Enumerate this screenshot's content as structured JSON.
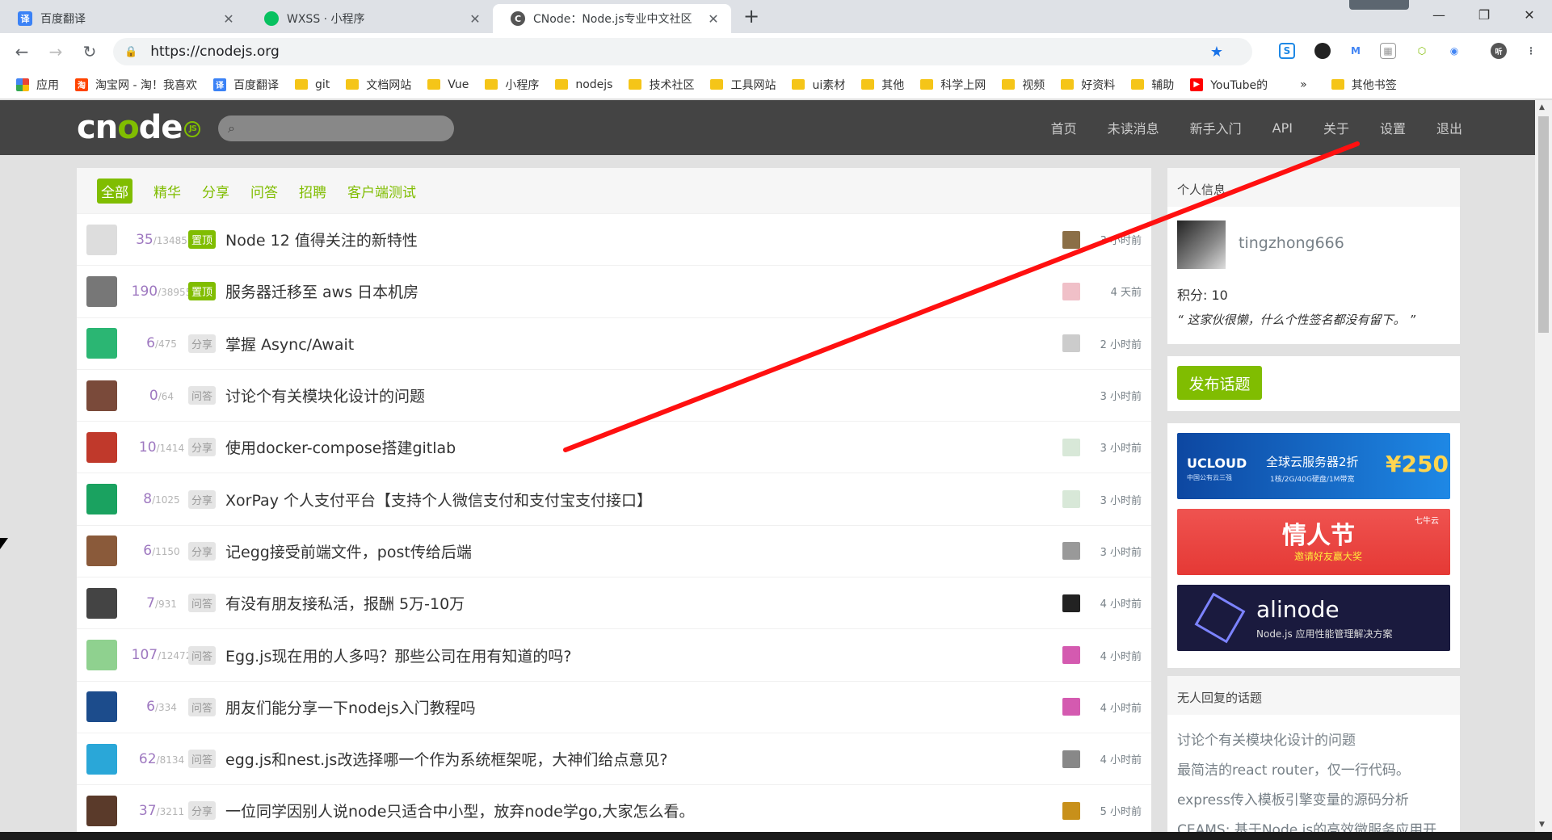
{
  "browser": {
    "tabs": [
      {
        "title": "百度翻译",
        "icon": "译",
        "color": "#3b82f6"
      },
      {
        "title": "WXSS · 小程序",
        "icon": "",
        "color": "#07c160"
      },
      {
        "title": "CNode：Node.js专业中文社区",
        "icon": "C",
        "color": "#555555"
      }
    ],
    "url": "https://cnodejs.org",
    "bookmarks": [
      {
        "label": "应用",
        "type": "apps"
      },
      {
        "label": "淘宝网 - 淘！我喜欢",
        "type": "taobao"
      },
      {
        "label": "百度翻译",
        "type": "translate"
      },
      {
        "label": "git",
        "type": "folder"
      },
      {
        "label": "文档网站",
        "type": "folder"
      },
      {
        "label": "Vue",
        "type": "folder"
      },
      {
        "label": "小程序",
        "type": "folder"
      },
      {
        "label": "nodejs",
        "type": "folder"
      },
      {
        "label": "技术社区",
        "type": "folder"
      },
      {
        "label": "工具网站",
        "type": "folder"
      },
      {
        "label": "ui素材",
        "type": "folder"
      },
      {
        "label": "其他",
        "type": "folder"
      },
      {
        "label": "科学上网",
        "type": "folder"
      },
      {
        "label": "视频",
        "type": "folder"
      },
      {
        "label": "好资料",
        "type": "folder"
      },
      {
        "label": "辅助",
        "type": "folder"
      },
      {
        "label": "YouTube的",
        "type": "youtube"
      }
    ],
    "more_bookmarks_label": "»",
    "other_bookmarks": "其他书签"
  },
  "site": {
    "menu": [
      "首页",
      "未读消息",
      "新手入门",
      "API",
      "关于",
      "设置",
      "退出"
    ],
    "tabs": [
      "全部",
      "精华",
      "分享",
      "问答",
      "招聘",
      "客户端测试"
    ],
    "topics": [
      {
        "replies": "35",
        "visits": "13485",
        "tag": "置顶",
        "tagType": "top",
        "title": "Node 12 值得关注的新特性",
        "time": "3 小时前",
        "avatar": "#ddd",
        "ravatar": "#8b6f47"
      },
      {
        "replies": "190",
        "visits": "38955",
        "tag": "置顶",
        "tagType": "top",
        "title": "服务器迁移至 aws 日本机房",
        "time": "4 天前",
        "avatar": "#777",
        "ravatar": "#f0c0c8"
      },
      {
        "replies": "6",
        "visits": "475",
        "tag": "分享",
        "tagType": "share",
        "title": "掌握 Async/Await",
        "time": "2 小时前",
        "avatar": "#2bb673",
        "ravatar": "#ccc"
      },
      {
        "replies": "0",
        "visits": "64",
        "tag": "问答",
        "tagType": "ask",
        "title": "讨论个有关模块化设计的问题",
        "time": "3 小时前",
        "avatar": "#7a4a3a",
        "ravatar": ""
      },
      {
        "replies": "10",
        "visits": "1414",
        "tag": "分享",
        "tagType": "share",
        "title": "使用docker-compose搭建gitlab",
        "time": "3 小时前",
        "avatar": "#c0392b",
        "ravatar": "#d8e8d8"
      },
      {
        "replies": "8",
        "visits": "1025",
        "tag": "分享",
        "tagType": "share",
        "title": "XorPay 个人支付平台【支持个人微信支付和支付宝支付接口】",
        "time": "3 小时前",
        "avatar": "#1aa260",
        "ravatar": "#d8e8d8"
      },
      {
        "replies": "6",
        "visits": "1150",
        "tag": "分享",
        "tagType": "share",
        "title": "记egg接受前端文件，post传给后端",
        "time": "3 小时前",
        "avatar": "#8a5a3a",
        "ravatar": "#999"
      },
      {
        "replies": "7",
        "visits": "931",
        "tag": "问答",
        "tagType": "ask",
        "title": "有没有朋友接私活，报酬 5万-10万",
        "time": "4 小时前",
        "avatar": "#444",
        "ravatar": "#222"
      },
      {
        "replies": "107",
        "visits": "12472",
        "tag": "问答",
        "tagType": "ask",
        "title": "Egg.js现在用的人多吗？那些公司在用有知道的吗?",
        "time": "4 小时前",
        "avatar": "#8fd18f",
        "ravatar": "#d45ab0"
      },
      {
        "replies": "6",
        "visits": "334",
        "tag": "问答",
        "tagType": "ask",
        "title": "朋友们能分享一下nodejs入门教程吗",
        "time": "4 小时前",
        "avatar": "#1c4c8c",
        "ravatar": "#d45ab0"
      },
      {
        "replies": "62",
        "visits": "8134",
        "tag": "问答",
        "tagType": "ask",
        "title": "egg.js和nest.js改选择哪一个作为系统框架呢，大神们给点意见?",
        "time": "4 小时前",
        "avatar": "#2aa7d8",
        "ravatar": "#888"
      },
      {
        "replies": "37",
        "visits": "3211",
        "tag": "分享",
        "tagType": "share",
        "title": "一位同学因别人说node只适合中小型，放弃node学go,大家怎么看。",
        "time": "5 小时前",
        "avatar": "#5a3a2a",
        "ravatar": "#c8901a"
      }
    ],
    "profile": {
      "header": "个人信息",
      "username": "tingzhong666",
      "score": "积分: 10",
      "signature": "“ 这家伙很懒，什么个性签名都没有留下。 ”"
    },
    "publish": "发布话题",
    "ads": [
      {
        "brand": "UCLOUD",
        "sub": "中国公有云三强",
        "text": "全球云服务器2折",
        "spec": "1核/2G/40G硬盘/1M带宽",
        "price": "¥250",
        "bg": "#1565c0"
      },
      {
        "brand": "七牛云",
        "text": "情人节",
        "sub": "邀请好友赢大奖",
        "bg": "#e53935"
      },
      {
        "brand": "alinode",
        "sub": "Node.js 应用性能管理解决方案",
        "bg": "#1a1a3e"
      }
    ],
    "noreply": {
      "header": "无人回复的话题",
      "items": [
        "讨论个有关模块化设计的问题",
        "最简洁的react router，仅一行代码。",
        "express传入模板引擎变量的源码分析",
        "CEAMS: 基于Node.js的高效微服务应用开..."
      ]
    }
  }
}
